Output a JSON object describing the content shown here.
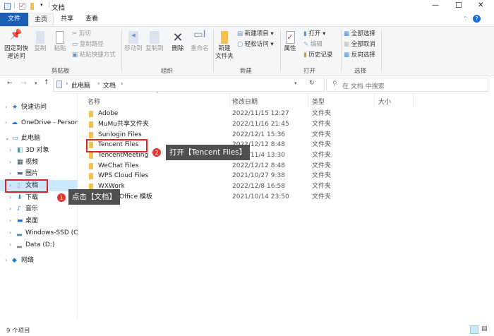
{
  "window": {
    "title": "文档",
    "minimize": "—",
    "maximize": "☐",
    "close": "✕",
    "help": "?"
  },
  "tabs": [
    {
      "label": "文件"
    },
    {
      "label": "主页"
    },
    {
      "label": "共享"
    },
    {
      "label": "查看"
    }
  ],
  "ribbon": {
    "clipboard": {
      "pin": "固定到快速访问",
      "pin2": "速访问",
      "pin1": "固定到快",
      "copy": "复制",
      "paste": "粘贴",
      "cut": "剪切",
      "copy_path": "复制路径",
      "paste_shortcut": "粘贴快捷方式",
      "label": "剪贴板"
    },
    "organize": {
      "move_to": "移动到",
      "copy_to": "复制到",
      "delete": "删除",
      "rename": "重命名",
      "label": "组织"
    },
    "new": {
      "new_folder_1": "新建",
      "new_folder_2": "文件夹",
      "new_item": "新建项目 ▾",
      "easy_access": "轻松访问 ▾",
      "label": "新建"
    },
    "open": {
      "properties": "属性",
      "open": "打开 ▾",
      "edit": "编辑",
      "history": "历史记录",
      "label": "打开"
    },
    "select": {
      "select_all": "全部选择",
      "select_none": "全部取消",
      "invert": "反向选择",
      "label": "选择"
    }
  },
  "address": {
    "crumbs": [
      "此电脑",
      "文档"
    ],
    "search_placeholder": "在 文档 中搜索"
  },
  "columns": {
    "name": "名称",
    "date": "修改日期",
    "type": "类型",
    "size": "大小"
  },
  "sidebar": [
    {
      "label": "快速访问"
    },
    {
      "label": "OneDrive - Persona"
    },
    {
      "label": "此电脑"
    },
    {
      "label": "3D 对象"
    },
    {
      "label": "视频"
    },
    {
      "label": "图片"
    },
    {
      "label": "文档"
    },
    {
      "label": "下载"
    },
    {
      "label": "音乐"
    },
    {
      "label": "桌面"
    },
    {
      "label": "Windows-SSD (C:)"
    },
    {
      "label": "Data (D:)"
    },
    {
      "label": "网络"
    }
  ],
  "files": [
    {
      "name": "Adobe",
      "date": "2022/11/15 12:27",
      "type": "文件夹"
    },
    {
      "name": "MuMu共享文件夹",
      "date": "2022/11/16 21:45",
      "type": "文件夹"
    },
    {
      "name": "Sunlogin Files",
      "date": "2022/12/1 15:36",
      "type": "文件夹"
    },
    {
      "name": "Tencent Files",
      "date": "2022/12/12 8:48",
      "type": "文件夹"
    },
    {
      "name": "TencentMeeting",
      "date": "2022/11/4 13:30",
      "type": "文件夹"
    },
    {
      "name": "WeChat Files",
      "date": "2022/12/12 8:48",
      "type": "文件夹"
    },
    {
      "name": "WPS Cloud Files",
      "date": "2021/10/27 9:38",
      "type": "文件夹"
    },
    {
      "name": "WXWork",
      "date": "2022/12/8 16:58",
      "type": "文件夹"
    },
    {
      "name": "自定义 Office 模板",
      "date": "2021/10/14 23:50",
      "type": "文件夹"
    }
  ],
  "status": {
    "count": "9 个项目"
  },
  "annotations": [
    {
      "num": "1",
      "text": "点击【文档】"
    },
    {
      "num": "2",
      "text": "打开【Tencent Files】"
    }
  ],
  "colors": {
    "accent": "#1a5fb4",
    "highlight": "#cce8ff",
    "annotation_red": "#e02424"
  }
}
